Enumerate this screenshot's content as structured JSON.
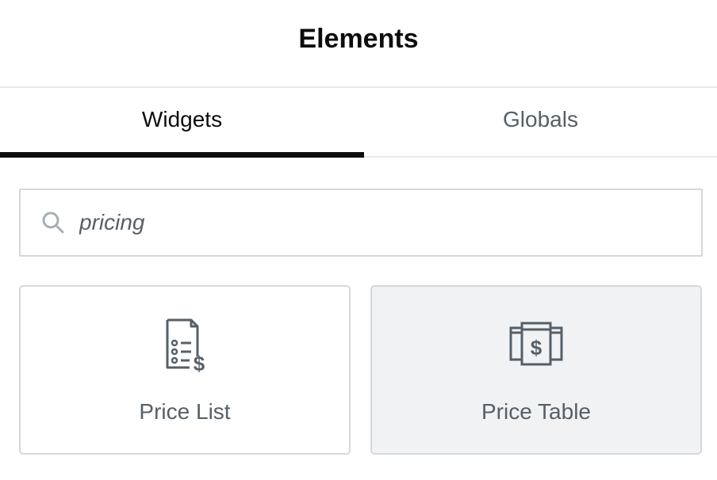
{
  "panel": {
    "title": "Elements"
  },
  "tabs": [
    {
      "label": "Widgets",
      "active": true
    },
    {
      "label": "Globals",
      "active": false
    }
  ],
  "search": {
    "value": "pricing",
    "icon": "search-icon"
  },
  "widgets": [
    {
      "label": "Price List",
      "icon": "price-list-icon",
      "highlighted": false
    },
    {
      "label": "Price Table",
      "icon": "price-table-icon",
      "highlighted": true
    }
  ],
  "colors": {
    "text_dark": "#0c0d0e",
    "text_muted": "#556068",
    "border": "#d5d8dc",
    "hover_bg": "#f1f2f3"
  }
}
